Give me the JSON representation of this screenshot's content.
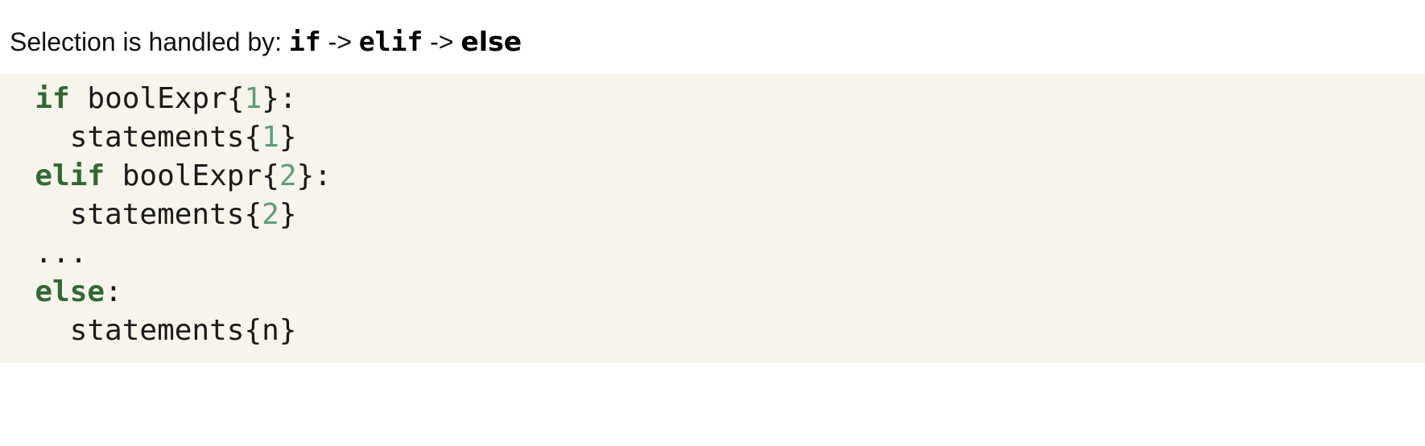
{
  "intro": {
    "prefix": "Selection is handled by: ",
    "kw1": "if",
    "arrow1": " -> ",
    "kw2": "elif",
    "arrow2": " -> ",
    "kw3": "else"
  },
  "code": {
    "line1": {
      "indent": "  ",
      "kw": "if",
      "text_a": " boolExpr{",
      "num": "1",
      "text_b": "}:"
    },
    "line2": {
      "indent": "    ",
      "text_a": "statements{",
      "num": "1",
      "text_b": "}"
    },
    "line3": {
      "indent": "  ",
      "kw": "elif",
      "text_a": " boolExpr{",
      "num": "2",
      "text_b": "}:"
    },
    "line4": {
      "indent": "    ",
      "text_a": "statements{",
      "num": "2",
      "text_b": "}"
    },
    "line5": {
      "indent": "  ",
      "text_a": "..."
    },
    "line6": {
      "indent": "  ",
      "kw": "else",
      "text_a": ":"
    },
    "line7": {
      "indent": "    ",
      "text_a": "statements{n}"
    }
  },
  "colors": {
    "keyword": "#2e6b31",
    "number": "#5b9e78",
    "code_background": "#f7f4ec"
  }
}
